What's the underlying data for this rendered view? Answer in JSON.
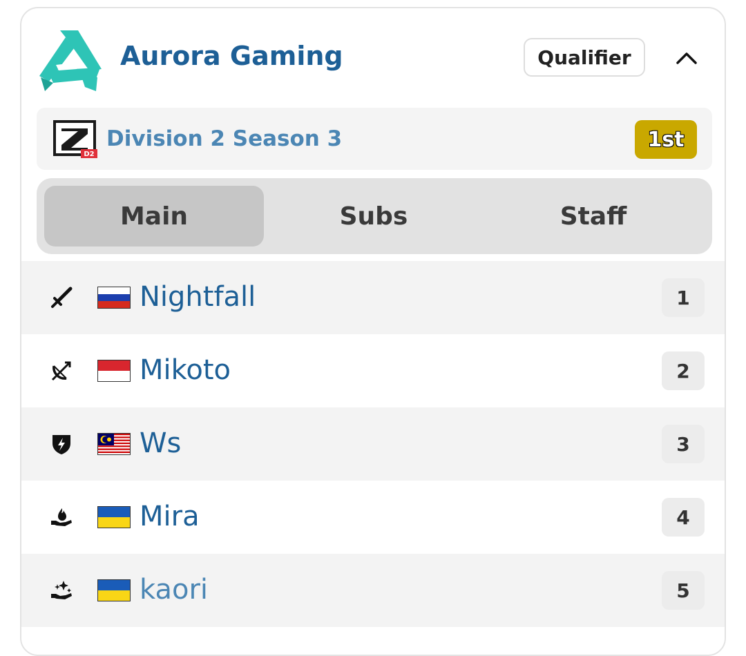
{
  "team": {
    "name": "Aurora Gaming",
    "logo_color": "#2ec4b6",
    "qualifier_label": "Qualifier",
    "collapse_icon": "chevron-up-icon"
  },
  "division": {
    "name": "Division 2 Season 3",
    "logo_badge": "D2",
    "placement": "1st",
    "placement_color": "#c9a800"
  },
  "tabs": [
    {
      "label": "Main",
      "active": true
    },
    {
      "label": "Subs",
      "active": false
    },
    {
      "label": "Staff",
      "active": false
    }
  ],
  "roster": [
    {
      "role_icon": "sword-icon",
      "flag": "russia-flag",
      "name": "Nightfall",
      "position": "1"
    },
    {
      "role_icon": "bow-icon",
      "flag": "indonesia-flag",
      "name": "Mikoto",
      "position": "2"
    },
    {
      "role_icon": "shield-icon",
      "flag": "malaysia-flag",
      "name": "Ws",
      "position": "3"
    },
    {
      "role_icon": "hand-flame-icon",
      "flag": "ukraine-flag",
      "name": "Mira",
      "position": "4"
    },
    {
      "role_icon": "hand-sparkle-icon",
      "flag": "ukraine-flag",
      "name": "kaori",
      "position": "5"
    }
  ]
}
